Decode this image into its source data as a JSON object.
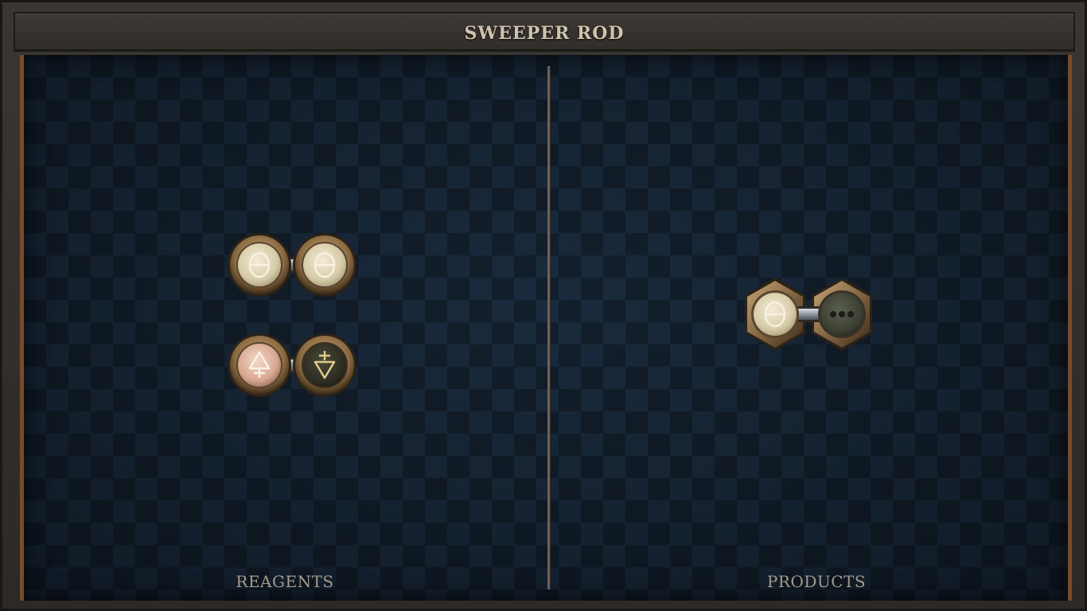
{
  "title": "SWEEPER ROD",
  "labels": {
    "reagents": "REAGENTS",
    "products": "PRODUCTS"
  },
  "reagents": [
    {
      "name": "salt-salt",
      "atoms": [
        {
          "element": "salt",
          "icon": "salt-symbol-icon",
          "glyph": "θ"
        },
        {
          "element": "salt",
          "icon": "salt-symbol-icon",
          "glyph": "θ"
        }
      ],
      "bond": "single"
    },
    {
      "name": "fire-water",
      "atoms": [
        {
          "element": "fire",
          "icon": "fire-symbol-icon",
          "glyph": "🜂"
        },
        {
          "element": "water",
          "icon": "water-symbol-icon",
          "glyph": "🜄"
        }
      ],
      "bond": "single"
    }
  ],
  "products": [
    {
      "name": "salt-quintessence",
      "atoms": [
        {
          "element": "salt",
          "icon": "salt-symbol-icon",
          "glyph": "θ"
        },
        {
          "element": "quintessence",
          "icon": "three-dots-icon",
          "glyph": "•••"
        }
      ],
      "bond": "single"
    }
  ],
  "colors": {
    "board": "#152232",
    "trim": "#7a4a2a",
    "brass": "#a98a5e",
    "salt_fill": "#e6dcc0",
    "fire_fill": "#e8c3ad",
    "water_fill": "#3a3a2c",
    "quintessence_fill": "#3f4538",
    "label_text": "#a39b8e"
  }
}
